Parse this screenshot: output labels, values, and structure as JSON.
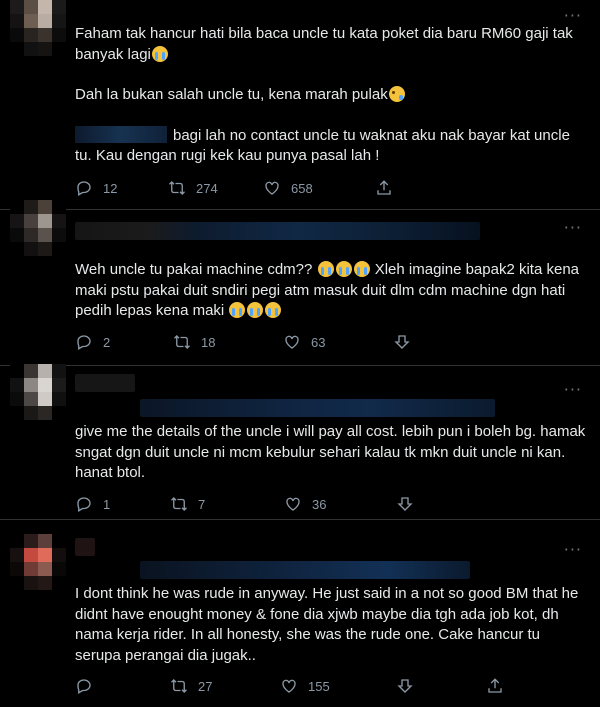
{
  "tweets": [
    {
      "lines": [
        {
          "text": "Faham tak hancur hati bila baca uncle tu kata poket dia baru RM60 gaji tak banyak lagi",
          "emoji": "crying"
        },
        {
          "text": "Dah la bukan salah uncle tu, kena marah pulak",
          "emoji": "sad"
        },
        {
          "text": "bagi lah no contact uncle tu waknat aku nak bayar kat uncle tu. Kau dengan rugi kek kau punya pasal lah !",
          "mention_blur": true
        }
      ],
      "reply_count": "12",
      "retweet_count": "274",
      "like_count": "658"
    },
    {
      "lines": [
        {
          "text_a": "Weh uncle tu pakai machine cdm??",
          "text_b": "Xleh imagine bapak2 kita kena maki pstu pakai duit sndiri pegi atm masuk duit dlm cdm machine dgn hati pedih lepas kena maki"
        }
      ],
      "reply_count": "2",
      "retweet_count": "18",
      "like_count": "63"
    },
    {
      "lines": [
        {
          "text": "give me the details of the uncle i will pay all cost. lebih pun i boleh bg. hamak sngat dgn duit uncle ni mcm kebulur sehari kalau tk mkn duit uncle ni kan. hanat btol."
        }
      ],
      "reply_count": "1",
      "retweet_count": "7",
      "like_count": "36"
    },
    {
      "lines": [
        {
          "text": "I dont think he was rude in anyway. He just said in a not so good BM that he didnt have enought money & fone dia xjwb maybe dia tgh ada job kot, dh nama kerja rider. In all honesty, she was the rude one. Cake hancur tu serupa perangai dia jugak.."
        }
      ],
      "reply_count": "",
      "retweet_count": "27",
      "like_count": "155"
    }
  ],
  "more_glyph": "···",
  "colors": {
    "background": "#000000",
    "text": "#e7e9ea",
    "muted": "#8b98a5",
    "divider": "#2f3336"
  },
  "icons": [
    "reply-icon",
    "retweet-icon",
    "like-icon",
    "share-icon",
    "downvote-icon",
    "more-icon"
  ]
}
